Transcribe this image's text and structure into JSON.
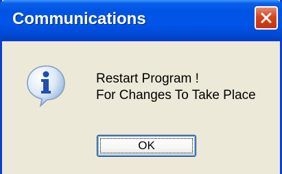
{
  "dialog": {
    "title": "Communications",
    "message_lines": [
      "Restart Program !",
      "For Changes To Take Place"
    ],
    "ok_label": "OK",
    "icons": {
      "info": "info-icon",
      "close": "close-icon"
    },
    "colors": {
      "title_bar": "#0054e3",
      "frame": "#0a3fd0",
      "body": "#ece9d8",
      "close_button": "#d8431c"
    }
  }
}
